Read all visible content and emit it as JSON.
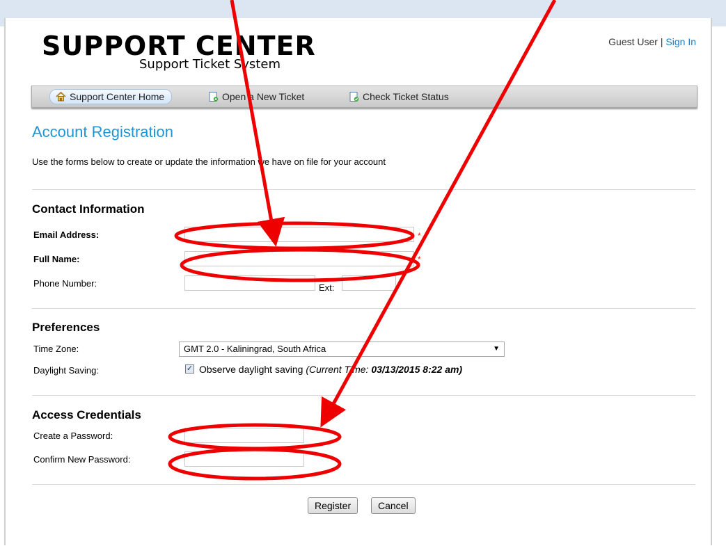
{
  "header": {
    "logo_main": "SUPPORT CENTER",
    "logo_sub": "Support Ticket System",
    "user_label": "Guest User",
    "separator": "|",
    "sign_in": "Sign In"
  },
  "nav": {
    "items": [
      {
        "label": "Support Center Home",
        "icon": "home-icon"
      },
      {
        "label": "Open a New Ticket",
        "icon": "document-new-icon"
      },
      {
        "label": "Check Ticket Status",
        "icon": "document-check-icon"
      }
    ]
  },
  "page": {
    "title": "Account Registration",
    "intro": "Use the forms below to create or update the information we have on file for your account"
  },
  "contact": {
    "title": "Contact Information",
    "email_label": "Email Address:",
    "name_label": "Full Name:",
    "phone_label": "Phone Number:",
    "ext_label": "Ext:",
    "required_mark": "*"
  },
  "preferences": {
    "title": "Preferences",
    "timezone_label": "Time Zone:",
    "timezone_value": "GMT 2.0 - Kaliningrad, South Africa",
    "dst_label": "Daylight Saving:",
    "dst_checked": true,
    "dst_text": "Observe daylight saving",
    "current_time_prefix": "(Current Time:",
    "current_time_value": "03/13/2015 8:22 am)"
  },
  "credentials": {
    "title": "Access Credentials",
    "password_label": "Create a Password:",
    "confirm_label": "Confirm New Password:"
  },
  "buttons": {
    "register": "Register",
    "cancel": "Cancel"
  },
  "colors": {
    "accent": "#1e95d4",
    "annotation": "#ee0000",
    "required": "#dd2222"
  }
}
